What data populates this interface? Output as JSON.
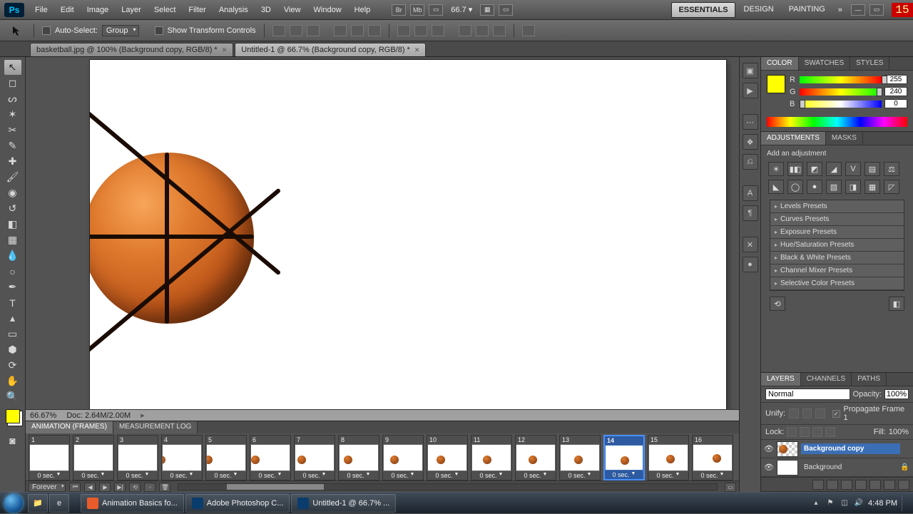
{
  "menubar": {
    "items": [
      "File",
      "Edit",
      "Image",
      "Layer",
      "Select",
      "Filter",
      "Analysis",
      "3D",
      "View",
      "Window",
      "Help"
    ],
    "zoom": "66.7",
    "workspaces": [
      "ESSENTIALS",
      "DESIGN",
      "PAINTING"
    ],
    "active_workspace": 0,
    "badge": "15"
  },
  "optbar": {
    "auto_select_label": "Auto-Select:",
    "auto_select_value": "Group",
    "transform_label": "Show Transform Controls"
  },
  "tabs": [
    {
      "title": "basketball.jpg @ 100% (Background copy, RGB/8) *",
      "active": false
    },
    {
      "title": "Untitled-1 @ 66.7% (Background copy, RGB/8) *",
      "active": true
    }
  ],
  "tools": [
    {
      "name": "move-tool",
      "glyph": "↖",
      "sel": true
    },
    {
      "name": "marquee-tool",
      "glyph": "◻"
    },
    {
      "name": "lasso-tool",
      "glyph": "ᔕ"
    },
    {
      "name": "quick-select-tool",
      "glyph": "✶"
    },
    {
      "name": "crop-tool",
      "glyph": "✂"
    },
    {
      "name": "eyedropper-tool",
      "glyph": "✎"
    },
    {
      "name": "healing-tool",
      "glyph": "✚"
    },
    {
      "name": "brush-tool",
      "glyph": "🖌"
    },
    {
      "name": "stamp-tool",
      "glyph": "◉"
    },
    {
      "name": "history-brush-tool",
      "glyph": "↺"
    },
    {
      "name": "eraser-tool",
      "glyph": "◧"
    },
    {
      "name": "gradient-tool",
      "glyph": "▦"
    },
    {
      "name": "blur-tool",
      "glyph": "💧"
    },
    {
      "name": "dodge-tool",
      "glyph": "○"
    },
    {
      "name": "pen-tool",
      "glyph": "✒"
    },
    {
      "name": "type-tool",
      "glyph": "T"
    },
    {
      "name": "path-select-tool",
      "glyph": "▴"
    },
    {
      "name": "shape-tool",
      "glyph": "▭"
    },
    {
      "name": "3d-tool",
      "glyph": "⬢"
    },
    {
      "name": "3d-camera-tool",
      "glyph": "⟳"
    },
    {
      "name": "hand-tool",
      "glyph": "✋"
    },
    {
      "name": "zoom-tool",
      "glyph": "🔍"
    }
  ],
  "foreground_color": "#ffff00",
  "status": {
    "zoom": "66.67%",
    "doc": "Doc: 2.64M/2.00M"
  },
  "animation": {
    "tabs": [
      "ANIMATION (FRAMES)",
      "MEASUREMENT LOG"
    ],
    "loop": "Forever",
    "selected_frame": 14,
    "frames": [
      {
        "n": 1,
        "delay": "0 sec.",
        "bx": -20,
        "by": 15
      },
      {
        "n": 2,
        "delay": "0 sec.",
        "bx": -16,
        "by": 15
      },
      {
        "n": 3,
        "delay": "0 sec.",
        "bx": -12,
        "by": 15
      },
      {
        "n": 4,
        "delay": "0 sec.",
        "bx": -8,
        "by": 15
      },
      {
        "n": 5,
        "delay": "0 sec.",
        "bx": -4,
        "by": 15
      },
      {
        "n": 6,
        "delay": "0 sec.",
        "bx": 0,
        "by": 15
      },
      {
        "n": 7,
        "delay": "0 sec.",
        "bx": 3,
        "by": 15
      },
      {
        "n": 8,
        "delay": "0 sec.",
        "bx": 6,
        "by": 15
      },
      {
        "n": 9,
        "delay": "0 sec.",
        "bx": 9,
        "by": 15
      },
      {
        "n": 10,
        "delay": "0 sec.",
        "bx": 12,
        "by": 15
      },
      {
        "n": 11,
        "delay": "0 sec.",
        "bx": 15,
        "by": 15
      },
      {
        "n": 12,
        "delay": "0 sec.",
        "bx": 17,
        "by": 15
      },
      {
        "n": 13,
        "delay": "0 sec.",
        "bx": 19,
        "by": 15
      },
      {
        "n": 14,
        "delay": "0 sec.",
        "bx": 21,
        "by": 15
      },
      {
        "n": 15,
        "delay": "0 sec.",
        "bx": 24,
        "by": 14
      },
      {
        "n": 16,
        "delay": "0 sec.",
        "bx": 27,
        "by": 13
      }
    ]
  },
  "color_panel": {
    "tabs": [
      "COLOR",
      "SWATCHES",
      "STYLES"
    ],
    "channels": [
      {
        "ch": "R",
        "val": "255",
        "pos": 100,
        "cls": "r"
      },
      {
        "ch": "G",
        "val": "240",
        "pos": 94,
        "cls": "g"
      },
      {
        "ch": "B",
        "val": "0",
        "pos": 0,
        "cls": "b"
      }
    ]
  },
  "adjustments": {
    "tabs": [
      "ADJUSTMENTS",
      "MASKS"
    ],
    "hint": "Add an adjustment",
    "icons": [
      "☀",
      "▮◧",
      "◩",
      "◢",
      "V",
      "▤",
      "⚖",
      "◣",
      "◯",
      "●",
      "▧",
      "◨",
      "▦",
      "◸"
    ],
    "presets": [
      "Levels Presets",
      "Curves Presets",
      "Exposure Presets",
      "Hue/Saturation Presets",
      "Black & White Presets",
      "Channel Mixer Presets",
      "Selective Color Presets"
    ]
  },
  "layers_panel": {
    "tabs": [
      "LAYERS",
      "CHANNELS",
      "PATHS"
    ],
    "blend": "Normal",
    "opacity_label": "Opacity:",
    "opacity": "100%",
    "unify_label": "Unify:",
    "propagate_label": "Propagate Frame 1",
    "propagate_checked": true,
    "lock_label": "Lock:",
    "fill_label": "Fill:",
    "fill": "100%",
    "layers": [
      {
        "name": "Background copy",
        "sel": true,
        "checker": true,
        "locked": false
      },
      {
        "name": "Background",
        "sel": false,
        "checker": false,
        "locked": true
      }
    ]
  },
  "dock_icons": [
    "▣",
    "▶",
    "⋯",
    "❖",
    "⎌",
    "A",
    "¶",
    "✕",
    "●"
  ],
  "taskbar": {
    "items": [
      {
        "label": "Animation Basics fo...",
        "color": "#e85c2b"
      },
      {
        "label": "Adobe Photoshop C...",
        "color": "#0a3c6e"
      },
      {
        "label": "Untitled-1 @ 66.7% ...",
        "color": "#0a3c6e"
      }
    ],
    "time": "4:48 PM"
  }
}
